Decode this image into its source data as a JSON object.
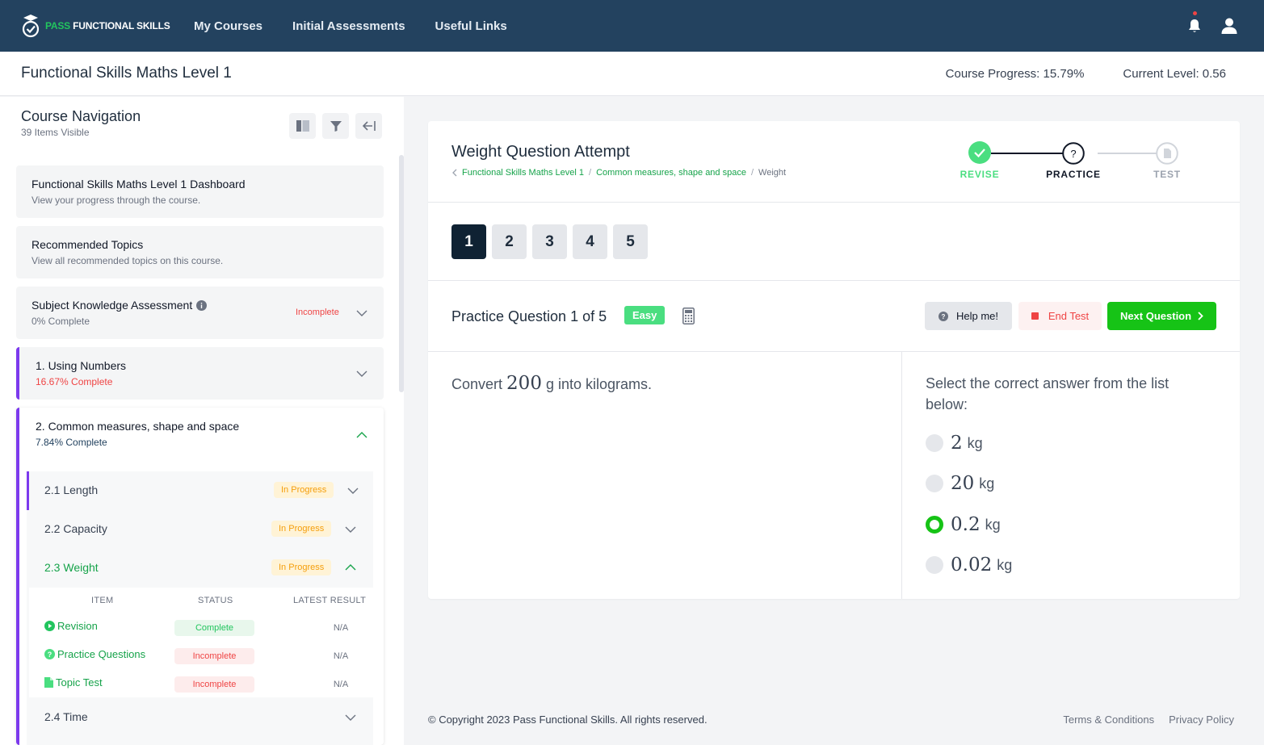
{
  "brand": {
    "pass": "PASS",
    "rest": " FUNCTIONAL SKILLS"
  },
  "nav": {
    "items": [
      "My Courses",
      "Initial Assessments",
      "Useful Links"
    ]
  },
  "header_icons": [
    "bell-icon",
    "user-icon"
  ],
  "course": {
    "title": "Functional Skills Maths Level 1",
    "progress_label": "Course Progress:",
    "progress_value": "15.79%",
    "level_label": "Current Level:",
    "level_value": "0.56"
  },
  "sidebar": {
    "title": "Course Navigation",
    "subtitle": "39 Items Visible",
    "dashboard": {
      "title": "Functional Skills Maths Level 1 Dashboard",
      "sub": "View your progress through the course."
    },
    "recommended": {
      "title": "Recommended Topics",
      "sub": "View all recommended topics on this course."
    },
    "ska": {
      "title": "Subject Knowledge Assessment",
      "sub": "0% Complete",
      "status": "Incomplete"
    },
    "unit1": {
      "title": "1. Using Numbers",
      "sub": "16.67% Complete"
    },
    "unit2": {
      "title": "2. Common measures, shape and space",
      "sub": "7.84% Complete"
    },
    "topics": [
      {
        "label": "2.1 Length",
        "status": "In Progress"
      },
      {
        "label": "2.2 Capacity",
        "status": "In Progress"
      },
      {
        "label": "2.3 Weight",
        "status": "In Progress"
      },
      {
        "label": "2.4 Time"
      }
    ],
    "table": {
      "headers": [
        "ITEM",
        "STATUS",
        "LATEST RESULT"
      ],
      "rows": [
        {
          "item": "Revision",
          "status": "Complete",
          "result": "N/A"
        },
        {
          "item": "Practice Questions",
          "status": "Incomplete",
          "result": "N/A"
        },
        {
          "item": "Topic Test",
          "status": "Incomplete",
          "result": "N/A"
        }
      ]
    }
  },
  "main": {
    "title": "Weight Question Attempt",
    "breadcrumb": [
      "Functional Skills Maths Level 1",
      "Common measures, shape and space",
      "Weight"
    ],
    "steps": [
      "REVISE",
      "PRACTICE",
      "TEST"
    ],
    "question_numbers": [
      "1",
      "2",
      "3",
      "4",
      "5"
    ],
    "practice_title": "Practice Question 1 of 5",
    "difficulty": "Easy",
    "buttons": {
      "help": "Help me!",
      "end": "End Test",
      "next": "Next Question"
    },
    "question": {
      "pre": "Convert",
      "value": "200",
      "post": "g into kilograms."
    },
    "answer_prompt": "Select the correct answer from the list below:",
    "options": [
      {
        "value": "2",
        "unit": "kg",
        "selected": false
      },
      {
        "value": "20",
        "unit": "kg",
        "selected": false
      },
      {
        "value": "0.2",
        "unit": "kg",
        "selected": true
      },
      {
        "value": "0.02",
        "unit": "kg",
        "selected": false
      }
    ]
  },
  "footer": {
    "copyright": "© Copyright 2023 Pass Functional Skills. All rights reserved.",
    "links": [
      "Terms & Conditions",
      "Privacy Policy"
    ]
  },
  "colors": {
    "nav_bg": "#23425f",
    "green": "#16c316",
    "accent": "#7c3aed",
    "red": "#ef4444"
  }
}
